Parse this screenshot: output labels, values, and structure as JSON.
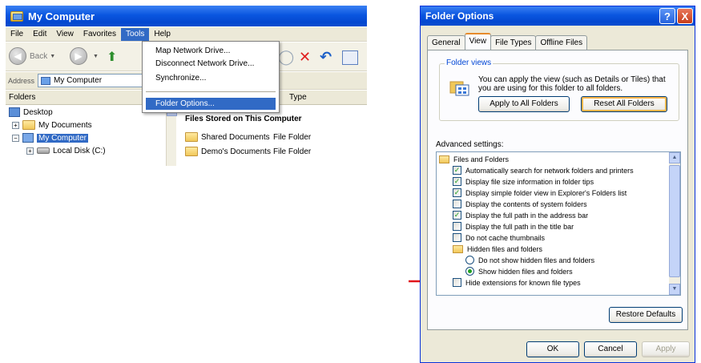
{
  "explorer": {
    "title": "My Computer",
    "menu": [
      "File",
      "Edit",
      "View",
      "Favorites",
      "Tools",
      "Help"
    ],
    "back_label": "Back",
    "address_label": "Address",
    "address_value": "My Computer",
    "folders_label": "Folders",
    "tree": {
      "desktop": "Desktop",
      "my_documents": "My Documents",
      "my_computer": "My Computer",
      "local_disk": "Local Disk (C:)"
    },
    "type_header": "Type",
    "group_header": "Files Stored on This Computer",
    "files": [
      {
        "name": "Shared Documents",
        "type": "File Folder"
      },
      {
        "name": "Demo's Documents",
        "type": "File Folder"
      }
    ],
    "tools_menu": {
      "map_drive": "Map Network Drive...",
      "disconnect_drive": "Disconnect Network Drive...",
      "synchronize": "Synchronize...",
      "folder_options": "Folder Options..."
    }
  },
  "dialog": {
    "title": "Folder Options",
    "help_glyph": "?",
    "close_glyph": "X",
    "tabs": [
      "General",
      "View",
      "File Types",
      "Offline Files"
    ],
    "folder_views": {
      "legend": "Folder views",
      "text": "You can apply the view (such as Details or Tiles) that you are using for this folder to all folders.",
      "apply_all": "Apply to All Folders",
      "reset_all": "Reset All Folders"
    },
    "advanced_label": "Advanced settings:",
    "items": [
      {
        "kind": "folder",
        "label": "Files and Folders"
      },
      {
        "kind": "check",
        "checked": true,
        "label": "Automatically search for network folders and printers"
      },
      {
        "kind": "check",
        "checked": true,
        "label": "Display file size information in folder tips"
      },
      {
        "kind": "check",
        "checked": true,
        "label": "Display simple folder view in Explorer's Folders list"
      },
      {
        "kind": "check",
        "checked": false,
        "label": "Display the contents of system folders"
      },
      {
        "kind": "check",
        "checked": true,
        "label": "Display the full path in the address bar"
      },
      {
        "kind": "check",
        "checked": false,
        "label": "Display the full path in the title bar"
      },
      {
        "kind": "check",
        "checked": false,
        "label": "Do not cache thumbnails"
      },
      {
        "kind": "folder",
        "label": "Hidden files and folders"
      },
      {
        "kind": "radio",
        "checked": false,
        "label": "Do not show hidden files and folders"
      },
      {
        "kind": "radio",
        "checked": true,
        "label": "Show hidden files and folders"
      },
      {
        "kind": "check",
        "checked": false,
        "label": "Hide extensions for known file types"
      }
    ],
    "restore_defaults": "Restore Defaults",
    "ok": "OK",
    "cancel": "Cancel",
    "apply": "Apply"
  },
  "colors": {
    "xp_blue": "#0a56e0",
    "selection": "#316ac5",
    "arrow": "#e0151a",
    "check_green": "#21a121"
  }
}
